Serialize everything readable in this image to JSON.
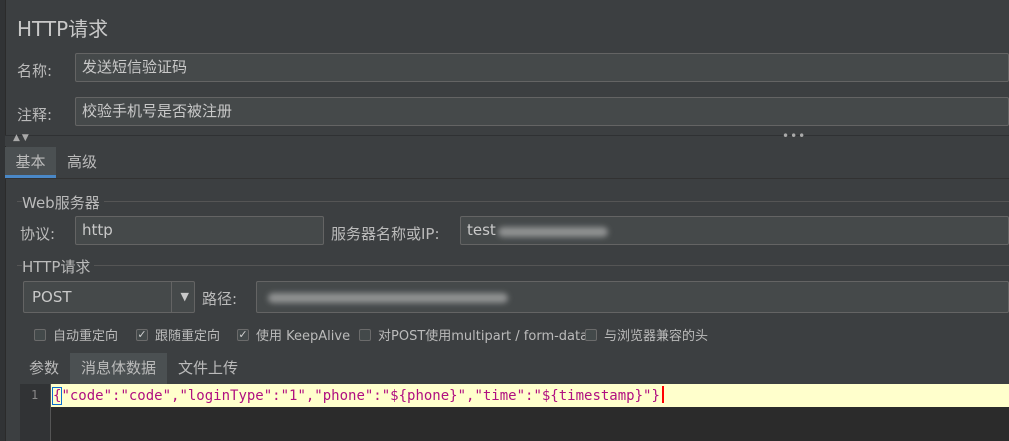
{
  "panel": {
    "title": "HTTP请求"
  },
  "name_field": {
    "label": "名称:",
    "value": "发送短信验证码"
  },
  "comment_field": {
    "label": "注释:",
    "value": "校验手机号是否被注册"
  },
  "main_tabs": [
    {
      "label": "基本",
      "active": true
    },
    {
      "label": "高级",
      "active": false
    }
  ],
  "web_server": {
    "group_title": "Web服务器",
    "protocol_label": "协议:",
    "protocol_value": "http",
    "server_label": "服务器名称或IP:",
    "server_value_visible": "test"
  },
  "http_request": {
    "group_title": "HTTP请求",
    "method": "POST",
    "path_label": "路径:"
  },
  "checkboxes": [
    {
      "label": "自动重定向",
      "checked": false
    },
    {
      "label": "跟随重定向",
      "checked": true
    },
    {
      "label": "使用 KeepAlive",
      "checked": true
    },
    {
      "label": "对POST使用multipart / form-data",
      "checked": false
    },
    {
      "label": "与浏览器兼容的头",
      "checked": false
    }
  ],
  "sub_tabs": [
    {
      "label": "参数",
      "active": false
    },
    {
      "label": "消息体数据",
      "active": true
    },
    {
      "label": "文件上传",
      "active": false
    }
  ],
  "editor": {
    "line_number": "1",
    "open_brace": "{",
    "body_rest": "\"code\":\"code\",\"loginType\":\"1\",\"phone\":\"${phone}\",\"time\":\"${timestamp}\"}"
  },
  "colors": {
    "background": "#3c3f41",
    "field_background": "#45494a",
    "active_tab_underline": "#4a88c7",
    "editor_highlight": "#ffffcc",
    "code_text": "#b01080",
    "caret": "#ff0000"
  }
}
